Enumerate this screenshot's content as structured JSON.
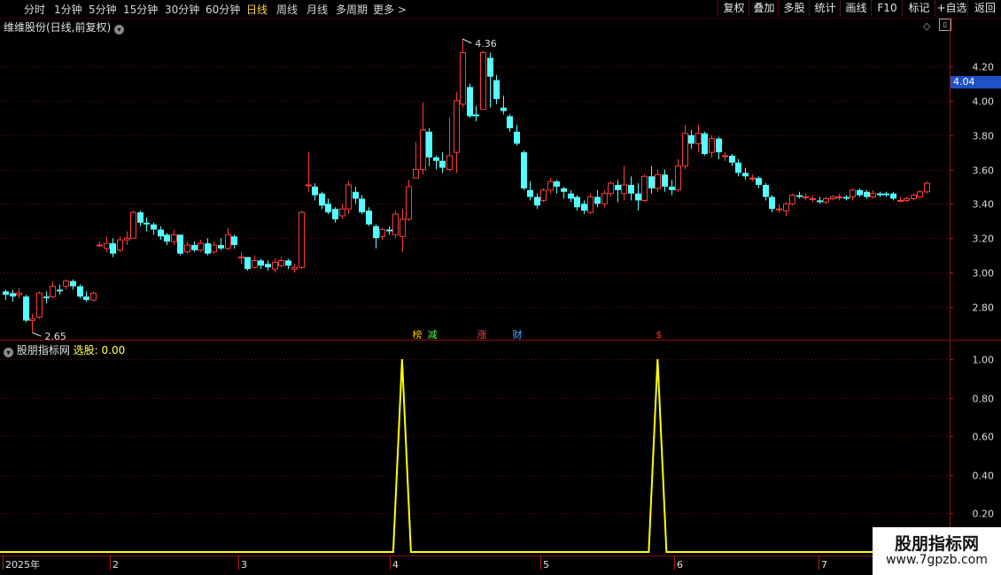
{
  "toolbar": {
    "tabs": [
      "分时",
      "1分钟",
      "5分钟",
      "15分钟",
      "30分钟",
      "60分钟",
      "日线",
      "周线",
      "月线",
      "多周期",
      "更多 >"
    ],
    "active_tab": "日线",
    "right_buttons": [
      "复权",
      "叠加",
      "多股",
      "统计",
      "画线",
      "F10",
      "标记",
      "+自选",
      "返回"
    ]
  },
  "main_panel": {
    "title": "维维股份(日线,前复权)",
    "high_label": "4.36",
    "low_label": "2.65",
    "current_price": "4.04",
    "y_ticks": [
      "4.20",
      "4.00",
      "3.80",
      "3.60",
      "3.40",
      "3.20",
      "3.00",
      "2.80"
    ],
    "markers": [
      {
        "text": "榜",
        "color": "#ffc000"
      },
      {
        "text": "减",
        "color": "#40ff40"
      },
      {
        "text": "涨",
        "color": "#ff4040"
      },
      {
        "text": "财",
        "color": "#4aa8ff"
      },
      {
        "text": "$",
        "color": "#ff3030"
      }
    ],
    "colors": {
      "up": "#ff3b3b",
      "down": "#54ffff",
      "grid": "#6a0a0a",
      "axis": "#8a1010"
    }
  },
  "indicator_panel": {
    "name": "股朋指标网",
    "label": "选股:",
    "value": "0.00",
    "y_ticks": [
      "1.00",
      "0.80",
      "0.60",
      "0.40",
      "0.20"
    ],
    "line_color": "#ffff00"
  },
  "x_axis": [
    "2025年",
    "2",
    "3",
    "4",
    "5",
    "6",
    "7"
  ],
  "watermark": {
    "title": "股朋指标网",
    "url": "www.7gpzb.com"
  },
  "chart_data": {
    "type": "candlestick",
    "y_range": [
      2.62,
      4.4
    ],
    "candles": [
      [
        2.89,
        2.87,
        2.9,
        2.84
      ],
      [
        2.88,
        2.86,
        2.9,
        2.83
      ],
      [
        2.87,
        2.88,
        2.91,
        2.85
      ],
      [
        2.86,
        2.72,
        2.87,
        2.71
      ],
      [
        2.72,
        2.73,
        2.76,
        2.65
      ],
      [
        2.74,
        2.88,
        2.89,
        2.73
      ],
      [
        2.86,
        2.85,
        2.89,
        2.82
      ],
      [
        2.86,
        2.92,
        2.95,
        2.85
      ],
      [
        2.9,
        2.89,
        2.93,
        2.87
      ],
      [
        2.92,
        2.95,
        2.96,
        2.9
      ],
      [
        2.95,
        2.92,
        2.96,
        2.9
      ],
      [
        2.92,
        2.86,
        2.93,
        2.85
      ],
      [
        2.86,
        2.84,
        2.89,
        2.83
      ],
      [
        2.84,
        2.88,
        2.89,
        2.83
      ],
      [
        3.16,
        3.16,
        3.18,
        3.15
      ],
      [
        3.14,
        3.17,
        3.21,
        3.12
      ],
      [
        3.17,
        3.11,
        3.2,
        3.09
      ],
      [
        3.13,
        3.19,
        3.21,
        3.12
      ],
      [
        3.19,
        3.2,
        3.24,
        3.16
      ],
      [
        3.2,
        3.35,
        3.36,
        3.2
      ],
      [
        3.35,
        3.29,
        3.36,
        3.27
      ],
      [
        3.29,
        3.28,
        3.32,
        3.24
      ],
      [
        3.28,
        3.25,
        3.29,
        3.22
      ],
      [
        3.25,
        3.21,
        3.27,
        3.19
      ],
      [
        3.22,
        3.18,
        3.23,
        3.16
      ],
      [
        3.18,
        3.22,
        3.25,
        3.16
      ],
      [
        3.22,
        3.11,
        3.22,
        3.1
      ],
      [
        3.12,
        3.16,
        3.18,
        3.11
      ],
      [
        3.16,
        3.13,
        3.18,
        3.12
      ],
      [
        3.13,
        3.17,
        3.19,
        3.12
      ],
      [
        3.17,
        3.11,
        3.2,
        3.1
      ],
      [
        3.12,
        3.16,
        3.18,
        3.11
      ],
      [
        3.16,
        3.14,
        3.2,
        3.13
      ],
      [
        3.14,
        3.22,
        3.26,
        3.13
      ],
      [
        3.21,
        3.16,
        3.22,
        3.14
      ],
      [
        3.09,
        3.09,
        3.12,
        3.05
      ],
      [
        3.09,
        3.02,
        3.09,
        3.01
      ],
      [
        3.03,
        3.07,
        3.1,
        3.02
      ],
      [
        3.07,
        3.04,
        3.08,
        3.02
      ],
      [
        3.05,
        3.03,
        3.07,
        3.01
      ],
      [
        3.02,
        3.06,
        3.08,
        3.0
      ],
      [
        3.04,
        3.07,
        3.09,
        3.03
      ],
      [
        3.07,
        3.04,
        3.08,
        3.02
      ],
      [
        3.02,
        3.03,
        3.05,
        3.0
      ],
      [
        3.03,
        3.35,
        3.36,
        3.02
      ],
      [
        3.51,
        3.51,
        3.7,
        3.47
      ],
      [
        3.5,
        3.45,
        3.52,
        3.42
      ],
      [
        3.46,
        3.39,
        3.47,
        3.37
      ],
      [
        3.4,
        3.35,
        3.43,
        3.34
      ],
      [
        3.37,
        3.31,
        3.38,
        3.29
      ],
      [
        3.33,
        3.37,
        3.4,
        3.31
      ],
      [
        3.37,
        3.51,
        3.53,
        3.34
      ],
      [
        3.47,
        3.43,
        3.5,
        3.4
      ],
      [
        3.43,
        3.35,
        3.45,
        3.34
      ],
      [
        3.36,
        3.28,
        3.38,
        3.27
      ],
      [
        3.27,
        3.2,
        3.28,
        3.14
      ],
      [
        3.21,
        3.25,
        3.26,
        3.19
      ],
      [
        3.25,
        3.24,
        3.27,
        3.22
      ],
      [
        3.22,
        3.34,
        3.36,
        3.2
      ],
      [
        3.21,
        3.31,
        3.37,
        3.12
      ],
      [
        3.31,
        3.5,
        3.54,
        3.3
      ],
      [
        3.55,
        3.6,
        3.76,
        3.55
      ],
      [
        3.6,
        3.83,
        3.99,
        3.57
      ],
      [
        3.82,
        3.67,
        3.84,
        3.62
      ],
      [
        3.67,
        3.65,
        3.68,
        3.6
      ],
      [
        3.65,
        3.61,
        3.7,
        3.58
      ],
      [
        3.6,
        3.68,
        3.9,
        3.59
      ],
      [
        3.7,
        4.0,
        4.05,
        3.58
      ],
      [
        3.98,
        4.28,
        4.36,
        3.96
      ],
      [
        4.08,
        3.91,
        4.1,
        3.9
      ],
      [
        3.92,
        3.91,
        3.97,
        3.88
      ],
      [
        3.95,
        4.28,
        4.29,
        3.95
      ],
      [
        4.25,
        4.14,
        4.28,
        3.96
      ],
      [
        4.12,
        4.01,
        4.15,
        3.98
      ],
      [
        3.96,
        3.94,
        4.03,
        3.92
      ],
      [
        3.91,
        3.84,
        3.92,
        3.82
      ],
      [
        3.82,
        3.75,
        3.86,
        3.74
      ],
      [
        3.7,
        3.49,
        3.71,
        3.48
      ],
      [
        3.48,
        3.44,
        3.53,
        3.42
      ],
      [
        3.44,
        3.39,
        3.46,
        3.37
      ],
      [
        3.42,
        3.48,
        3.49,
        3.41
      ],
      [
        3.48,
        3.53,
        3.55,
        3.46
      ],
      [
        3.53,
        3.5,
        3.54,
        3.46
      ],
      [
        3.49,
        3.47,
        3.5,
        3.43
      ],
      [
        3.46,
        3.43,
        3.48,
        3.41
      ],
      [
        3.44,
        3.38,
        3.45,
        3.36
      ],
      [
        3.4,
        3.36,
        3.42,
        3.34
      ],
      [
        3.35,
        3.44,
        3.46,
        3.34
      ],
      [
        3.44,
        3.4,
        3.48,
        3.38
      ],
      [
        3.4,
        3.46,
        3.48,
        3.38
      ],
      [
        3.46,
        3.52,
        3.53,
        3.44
      ],
      [
        3.51,
        3.48,
        3.54,
        3.41
      ],
      [
        3.46,
        3.51,
        3.62,
        3.42
      ],
      [
        3.51,
        3.46,
        3.56,
        3.42
      ],
      [
        3.46,
        3.42,
        3.52,
        3.36
      ],
      [
        3.42,
        3.56,
        3.57,
        3.41
      ],
      [
        3.56,
        3.49,
        3.62,
        3.46
      ],
      [
        3.49,
        3.57,
        3.6,
        3.47
      ],
      [
        3.57,
        3.5,
        3.6,
        3.47
      ],
      [
        3.5,
        3.48,
        3.54,
        3.45
      ],
      [
        3.48,
        3.62,
        3.66,
        3.47
      ],
      [
        3.62,
        3.81,
        3.86,
        3.6
      ],
      [
        3.8,
        3.75,
        3.83,
        3.72
      ],
      [
        3.75,
        3.81,
        3.86,
        3.7
      ],
      [
        3.81,
        3.69,
        3.82,
        3.68
      ],
      [
        3.7,
        3.78,
        3.8,
        3.67
      ],
      [
        3.78,
        3.7,
        3.79,
        3.66
      ],
      [
        3.68,
        3.68,
        3.7,
        3.65
      ],
      [
        3.68,
        3.64,
        3.69,
        3.62
      ],
      [
        3.64,
        3.58,
        3.66,
        3.56
      ],
      [
        3.58,
        3.56,
        3.61,
        3.54
      ],
      [
        3.55,
        3.55,
        3.57,
        3.53
      ],
      [
        3.55,
        3.51,
        3.56,
        3.49
      ],
      [
        3.51,
        3.44,
        3.52,
        3.42
      ],
      [
        3.44,
        3.37,
        3.45,
        3.35
      ],
      [
        3.37,
        3.37,
        3.4,
        3.35
      ],
      [
        3.36,
        3.4,
        3.41,
        3.33
      ],
      [
        3.4,
        3.45,
        3.46,
        3.39
      ],
      [
        3.45,
        3.44,
        3.47,
        3.43
      ],
      [
        3.44,
        3.44,
        3.46,
        3.42
      ],
      [
        3.43,
        3.43,
        3.45,
        3.41
      ],
      [
        3.42,
        3.41,
        3.44,
        3.4
      ],
      [
        3.41,
        3.43,
        3.44,
        3.4
      ],
      [
        3.43,
        3.44,
        3.45,
        3.42
      ],
      [
        3.44,
        3.44,
        3.46,
        3.42
      ],
      [
        3.44,
        3.43,
        3.45,
        3.42
      ],
      [
        3.44,
        3.48,
        3.49,
        3.42
      ],
      [
        3.48,
        3.45,
        3.49,
        3.44
      ],
      [
        3.47,
        3.44,
        3.48,
        3.43
      ],
      [
        3.44,
        3.46,
        3.48,
        3.43
      ],
      [
        3.46,
        3.45,
        3.47,
        3.44
      ],
      [
        3.46,
        3.45,
        3.47,
        3.44
      ],
      [
        3.46,
        3.43,
        3.47,
        3.42
      ],
      [
        3.42,
        3.42,
        3.44,
        3.41
      ],
      [
        3.42,
        3.43,
        3.44,
        3.41
      ],
      [
        3.43,
        3.45,
        3.46,
        3.42
      ],
      [
        3.44,
        3.47,
        3.48,
        3.43
      ],
      [
        3.47,
        3.52,
        3.53,
        3.46
      ]
    ],
    "indicator": {
      "spikes": [
        {
          "index": 59,
          "value": 1.0
        },
        {
          "index": 97,
          "value": 1.0
        }
      ],
      "y_range": [
        0,
        1.05
      ]
    }
  }
}
